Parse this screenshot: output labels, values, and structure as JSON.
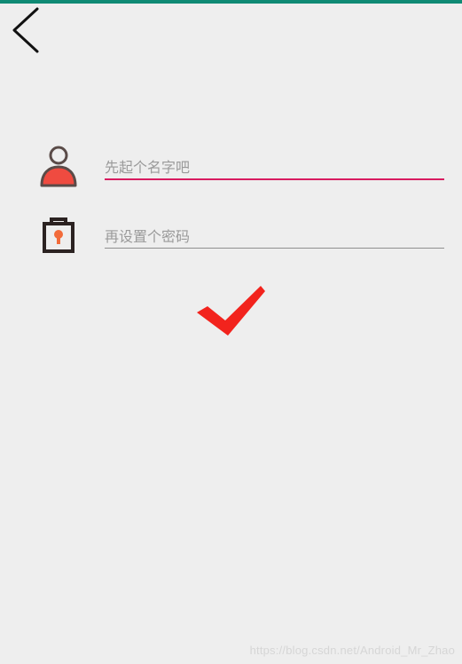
{
  "app": {
    "accent_color": "#0f8a74"
  },
  "toolbar": {
    "back_icon": "back-arrow-icon"
  },
  "form": {
    "username": {
      "placeholder": "先起个名字吧",
      "value": "",
      "icon": "user-icon",
      "focused": true,
      "underline_color": "#d81b60"
    },
    "password": {
      "placeholder": "再设置个密码",
      "value": "",
      "icon": "lock-icon",
      "underline_color": "#8f8f8f"
    },
    "confirm": {
      "icon": "checkmark-icon",
      "color": "#f2231d"
    }
  },
  "footer": {
    "watermark": "https://blog.csdn.net/Android_Mr_Zhao"
  }
}
